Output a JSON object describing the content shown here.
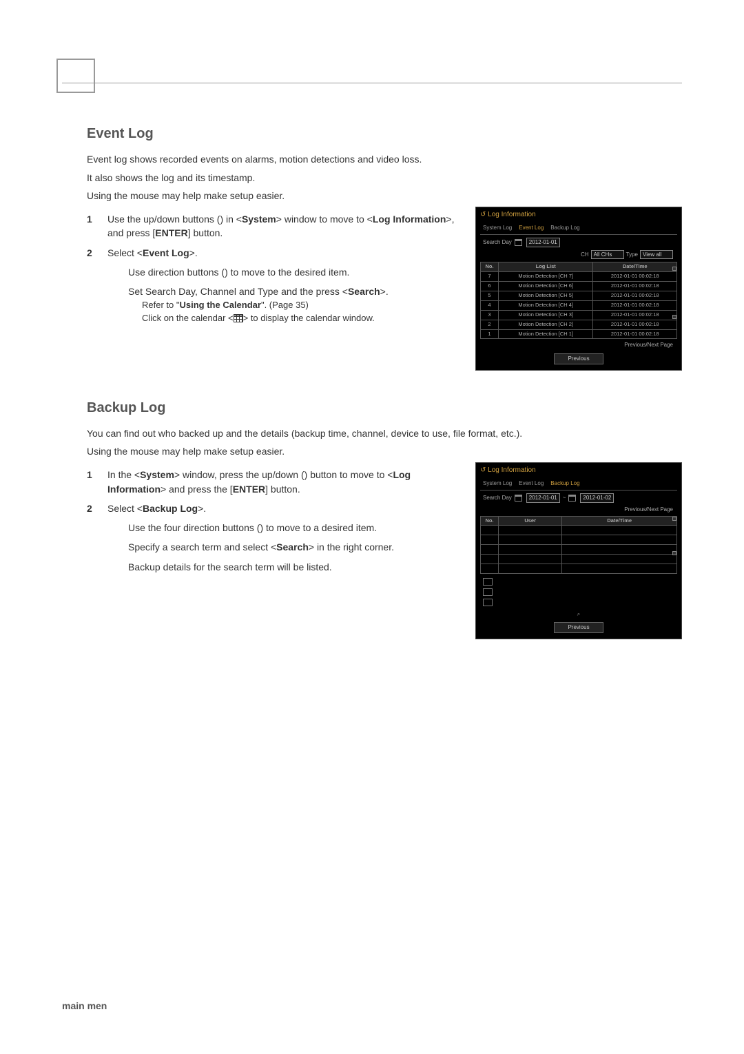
{
  "page": {
    "footer_label": "main men"
  },
  "event_log": {
    "heading": "Event Log",
    "intro_line1": "Event log shows recorded events on alarms, motion detections and video loss.",
    "intro_line2": "It also shows the log and its timestamp.",
    "mouse_tip": "Using the mouse may help make setup easier.",
    "step1_a": "Use the up/down buttons (",
    "step1_b": ") in <",
    "step1_system": "System",
    "step1_c": "> window to move to <",
    "step1_loginfo": "Log Information",
    "step1_d": ">, and press [",
    "step1_enter": "ENTER",
    "step1_e": "] button.",
    "step2_a": "Select <",
    "step2_event": "Event Log",
    "step2_b": ">.",
    "step2_sub1_a": "Use direction buttons (",
    "step2_sub1_b": ") to move to the desired item.",
    "step2_sub2_a": "Set Search Day, Channel and Type and the press <",
    "step2_sub2_search": "Search",
    "step2_sub2_b": ">.",
    "tip1_a": "Refer to \"",
    "tip1_bold": "Using the Calendar",
    "tip1_b": "\". (Page 35)",
    "tip2_a": "Click on the calendar <",
    "tip2_b": "> to display the calendar window."
  },
  "backup_log": {
    "heading": "Backup Log",
    "intro": "You can find out who backed up and the details (backup time, channel, device to use, file format, etc.).",
    "mouse_tip": "Using the mouse may help make setup easier.",
    "step1_a": "In the <",
    "step1_system": "System",
    "step1_b": "> window, press the up/down (",
    "step1_c": ") button to move to <",
    "step1_loginfo": "Log Information",
    "step1_d": "> and press the [",
    "step1_enter": "ENTER",
    "step1_e": "] button.",
    "step2_a": "Select <",
    "step2_backup": "Backup Log",
    "step2_b": ">.",
    "step2_sub1_a": "Use the four direction buttons (",
    "step2_sub1_b": ") to move to a desired item.",
    "step2_sub2_a": "Specify a search term and select <",
    "step2_sub2_search": "Search",
    "step2_sub2_b": "> in the right corner.",
    "step2_sub3": "Backup details for the search term will be listed."
  },
  "dvr1": {
    "window_title": "Log Information",
    "tabs": {
      "system": "System Log",
      "event": "Event Log",
      "backup": "Backup Log"
    },
    "search_day_label": "Search Day",
    "search_day_value": "2012-01-01",
    "ch_label": "CH",
    "ch_value": "All CHs",
    "type_label": "Type",
    "type_value": "View all",
    "col_no": "No.",
    "col_loglist": "Log List",
    "col_datetime": "Date/Time",
    "rows": [
      {
        "no": "7",
        "log": "Motion Detection [CH 7]",
        "dt": "2012-01-01 00:02:18"
      },
      {
        "no": "6",
        "log": "Motion Detection [CH 6]",
        "dt": "2012-01-01 00:02:18"
      },
      {
        "no": "5",
        "log": "Motion Detection [CH 5]",
        "dt": "2012-01-01 00:02:18"
      },
      {
        "no": "4",
        "log": "Motion Detection [CH 4]",
        "dt": "2012-01-01 00:02:18"
      },
      {
        "no": "3",
        "log": "Motion Detection [CH 3]",
        "dt": "2012-01-01 00:02:18"
      },
      {
        "no": "2",
        "log": "Motion Detection [CH 2]",
        "dt": "2012-01-01 00:02:18"
      },
      {
        "no": "1",
        "log": "Motion Detection [CH 1]",
        "dt": "2012-01-01 00:02:18"
      }
    ],
    "pager": "Previous/Next Page",
    "previous_btn": "Previous"
  },
  "dvr2": {
    "window_title": "Log Information",
    "tabs": {
      "system": "System Log",
      "event": "Event Log",
      "backup": "Backup Log"
    },
    "search_day_label": "Search Day",
    "date_from": "2012-01-01",
    "date_sep": "~",
    "date_to": "2012-01-02",
    "pager": "Previous/Next Page",
    "col_no": "No.",
    "col_user": "User",
    "col_datetime": "Date/Time",
    "previous_btn": "Previous"
  }
}
